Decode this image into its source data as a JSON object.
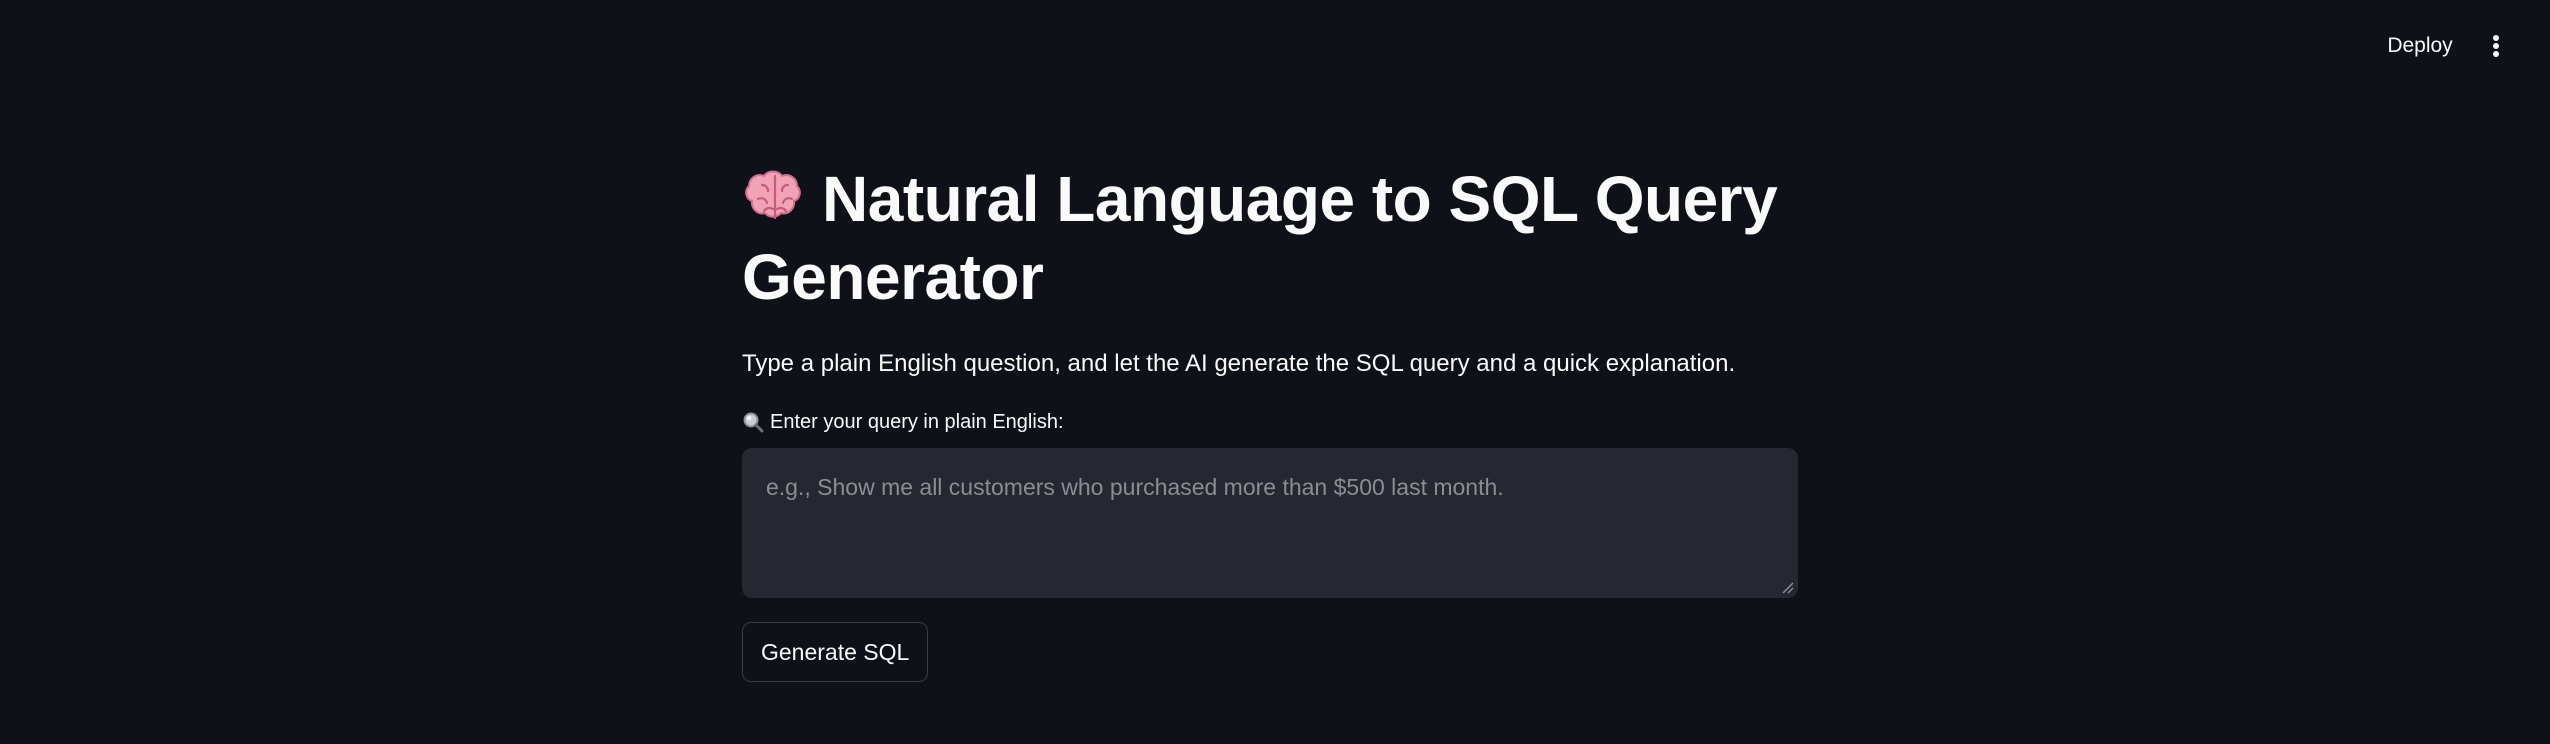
{
  "header": {
    "deploy_label": "Deploy",
    "menu_icon": "vertical-dots-icon"
  },
  "main": {
    "title": "Natural Language to SQL Query Generator",
    "title_icon": "brain-emoji-icon",
    "subtitle": "Type a plain English question, and let the AI generate the SQL query and a quick explanation.",
    "input_label": "Enter your query in plain English:",
    "input_label_icon": "magnifying-glass-icon",
    "input_value": "",
    "input_placeholder": "e.g., Show me all customers who purchased more than $500 last month.",
    "button_label": "Generate SQL"
  },
  "colors": {
    "background": "#0e1117",
    "input_background": "#262730",
    "text": "#fafafa",
    "placeholder": "#8b8d93",
    "button_border": "#3a3c45"
  }
}
